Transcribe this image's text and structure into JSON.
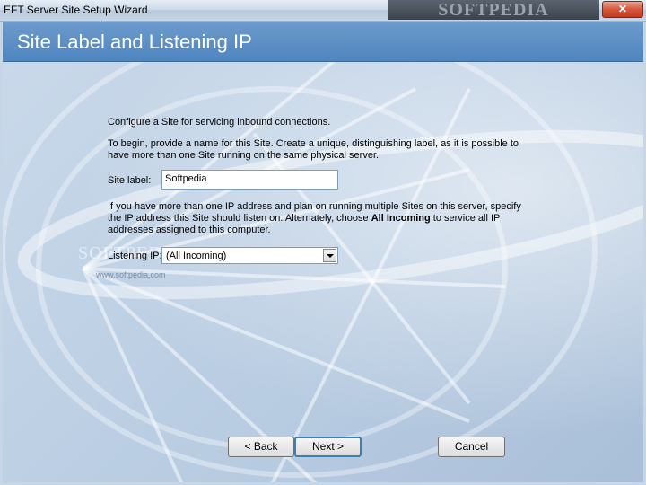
{
  "window": {
    "title": "EFT Server Site Setup Wizard",
    "watermark": "SOFTPEDIA",
    "close_label": "✕"
  },
  "header": {
    "title": "Site Label and Listening IP"
  },
  "content": {
    "intro": "Configure a Site for servicing inbound connections.",
    "description": "To begin, provide a name for this Site. Create a unique, distinguishing label, as it is possible to have more than one Site running on the same physical server.",
    "site_label": {
      "label": "Site label:",
      "value": "Softpedia"
    },
    "ip_help": {
      "before": "If you have more than one IP address and plan on running multiple Sites on this server, specify the IP address this Site should listen on. Alternately, choose ",
      "bold": "All Incoming",
      "after": " to service all IP addresses assigned to this computer."
    },
    "listening_ip": {
      "label": "Listening IP:",
      "value": "(All Incoming)"
    },
    "watermark_big": "SOFTPEDIA",
    "watermark_small": "www.softpedia.com"
  },
  "buttons": {
    "back": "< Back",
    "next": "Next >",
    "cancel": "Cancel"
  },
  "colors": {
    "header_blue": "#5a8fc7",
    "close_red": "#d5573c"
  }
}
